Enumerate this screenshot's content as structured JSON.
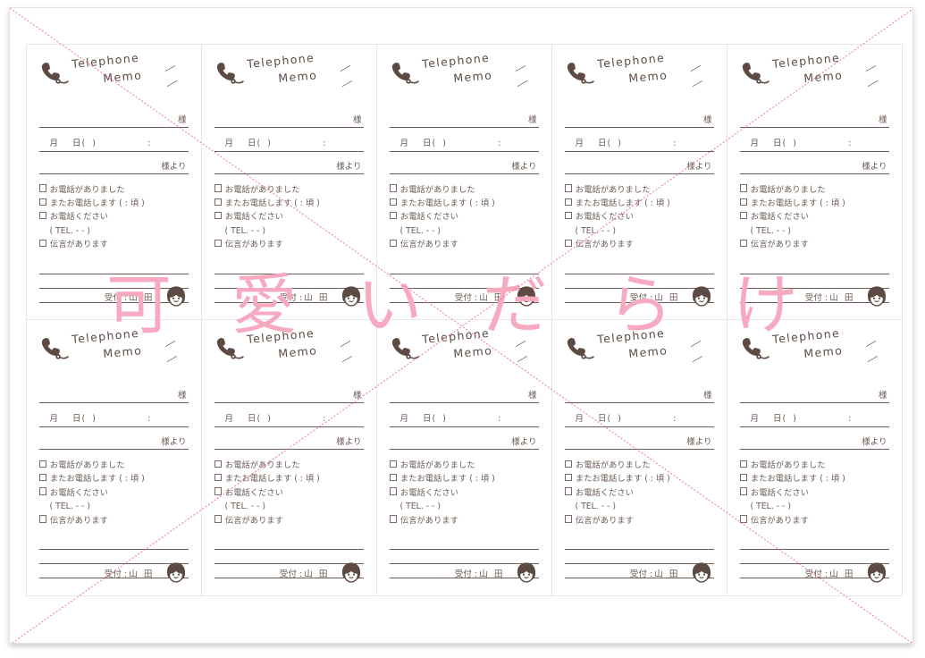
{
  "page": {
    "watermark": "可 愛 い だ ら け",
    "watermark_color": "#f7a9c0",
    "ink_color": "#6b5b53",
    "sheet_border_color": "#e3e3e3",
    "card_border_color": "#e6e6e6",
    "diagonal_color": "#ec5f9a"
  },
  "card": {
    "title_line1": "Telephone",
    "title_line2": "Memo",
    "phone_icon": "telephone-handset-icon",
    "girl_icon": "girl-face-icon",
    "recipient_suffix": "様",
    "date_month": "月",
    "date_day": "日",
    "date_paren_open": "(",
    "date_paren_close": ")",
    "time_colon": ":",
    "from_suffix": "様より",
    "check_called": "お電話がありました",
    "check_call_again": "またお電話します (     :     頃 )",
    "check_please_call": "お電話ください",
    "tel_line": "( TEL.           -           -            )",
    "check_message": "伝言があります",
    "received_label": "受付 :",
    "received_name": "山 田"
  },
  "cards": [
    {
      "id": "card-1",
      "row": 1,
      "col": 1
    },
    {
      "id": "card-2",
      "row": 1,
      "col": 2
    },
    {
      "id": "card-3",
      "row": 1,
      "col": 3
    },
    {
      "id": "card-4",
      "row": 1,
      "col": 4
    },
    {
      "id": "card-5",
      "row": 1,
      "col": 5
    },
    {
      "id": "card-6",
      "row": 2,
      "col": 1
    },
    {
      "id": "card-7",
      "row": 2,
      "col": 2
    },
    {
      "id": "card-8",
      "row": 2,
      "col": 3
    },
    {
      "id": "card-9",
      "row": 2,
      "col": 4
    },
    {
      "id": "card-10",
      "row": 2,
      "col": 5
    }
  ]
}
